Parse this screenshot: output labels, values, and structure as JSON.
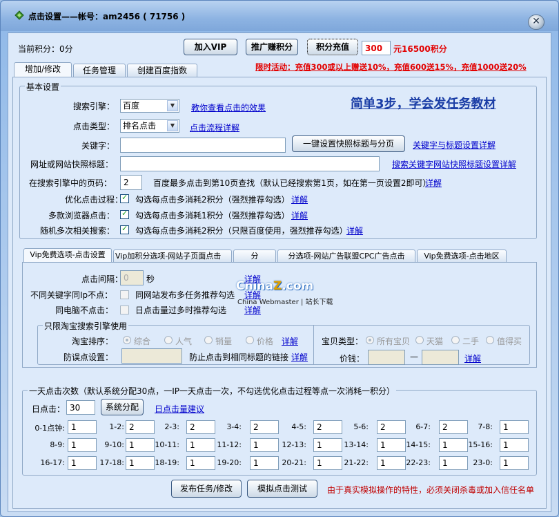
{
  "window": {
    "title": "点击设置——帐号：am2456 ( 71756 )",
    "close": "✕"
  },
  "top": {
    "points_label": "当前积分：0分",
    "vip_button": "加入VIP",
    "promo_button": "推广赚积分",
    "recharge_button": "积分充值",
    "recharge_amount": "300",
    "recharge_result": "元16500积分",
    "promo_notice": "限时活动：充值300或以上赠送10%，充值600送15%，充值1000送20%"
  },
  "tabs": [
    "增加/修改",
    "任务管理",
    "创建百度指数"
  ],
  "basic": {
    "legend": "基本设置",
    "engine_label": "搜索引擎：",
    "engine_value": "百度",
    "engine_link": "教你查看点击的效果",
    "slogan": "简单3步，学会发任务教材",
    "click_type_label": "点击类型：",
    "click_type_value": "排名点击",
    "click_type_link": "点击流程详解",
    "keyword_label": "关键字：",
    "keyword_value": "",
    "snapshot_button": "一键设置快照标题与分页",
    "snapshot_link": "关键字与标题设置详解",
    "url_label": "网址或网站快照标题：",
    "url_value": "",
    "url_link": "搜索关键字网站快照标题设置详解",
    "page_label": "在搜索引擎中的页码：",
    "page_value": "2",
    "page_hint": "百度最多点击到第10页查找（默认已经搜索第1页，如在第一页设置2即可）",
    "page_link": "详解",
    "opt1_label": "优化点击过程：",
    "opt1_text": "勾选每点击多消耗2积分（强烈推荐勾选）",
    "opt2_label": "多款浏览器点击：",
    "opt2_text": "勾选每点击多消耗1积分（强烈推荐勾选）",
    "opt3_label": "随机多次相关搜索：",
    "opt3_text": "勾选每点击多消耗2积分（只限百度使用，强烈推荐勾选）",
    "detail": "详解"
  },
  "subtabs": [
    "Vip免费选项-点击设置",
    "Vip加积分选项-网站子页面点击",
    "分",
    "分选项-网站广告联盟CPC广告点击",
    "Vip免费选项-点击地区"
  ],
  "watermark": {
    "logo": "China",
    "logo_z": "Z",
    "logo_end": ".com",
    "sub": "China Webmaster | 站长下载"
  },
  "vip": {
    "interval_label": "点击间隔：",
    "interval_value": "0",
    "interval_unit": "秒",
    "ip_label": "不同关键字同Ip不点：",
    "ip_text": "同网站发布多任务推荐勾选",
    "pc_label": "同电脑不点击：",
    "pc_text": "日点击量过多时推荐勾选",
    "detail": "详解",
    "taobao_legend": "只限淘宝搜索引擎使用",
    "sort_label": "淘宝排序：",
    "sort_options": [
      "综合",
      "人气",
      "销量",
      "价格"
    ],
    "antifake_label": "防误点设置：",
    "antifake_hint": "防止点击到相同标题的链接",
    "type_label": "宝贝类型：",
    "type_options": [
      "所有宝贝",
      "天猫",
      "二手",
      "值得买"
    ],
    "price_label": "价钱：",
    "price_sep": "—"
  },
  "daily": {
    "legend": "一天点击次数（默认系统分配30点，一IP一天点击一次，不勾选优化点击过程等点一次消耗一积分）",
    "day_label": "日点击：",
    "day_value": "30",
    "assign_button": "系统分配",
    "suggest_link": "日点击量建议",
    "slots": [
      {
        "label": "0-1点钟:",
        "value": "1"
      },
      {
        "label": "1-2:",
        "value": "2"
      },
      {
        "label": "2-3:",
        "value": "2"
      },
      {
        "label": "3-4:",
        "value": "2"
      },
      {
        "label": "4-5:",
        "value": "2"
      },
      {
        "label": "5-6:",
        "value": "2"
      },
      {
        "label": "6-7:",
        "value": "2"
      },
      {
        "label": "7-8:",
        "value": "1"
      },
      {
        "label": "8-9:",
        "value": "1"
      },
      {
        "label": "9-10:",
        "value": "1"
      },
      {
        "label": "10-11:",
        "value": "1"
      },
      {
        "label": "11-12:",
        "value": "1"
      },
      {
        "label": "12-13:",
        "value": "1"
      },
      {
        "label": "13-14:",
        "value": "1"
      },
      {
        "label": "14-15:",
        "value": "1"
      },
      {
        "label": "15-16:",
        "value": "1"
      },
      {
        "label": "16-17:",
        "value": "1"
      },
      {
        "label": "17-18:",
        "value": "1"
      },
      {
        "label": "18-19:",
        "value": "1"
      },
      {
        "label": "19-20:",
        "value": "1"
      },
      {
        "label": "20-21:",
        "value": "1"
      },
      {
        "label": "21-22:",
        "value": "1"
      },
      {
        "label": "22-23:",
        "value": "1"
      },
      {
        "label": "23-0:",
        "value": "1"
      }
    ]
  },
  "footer": {
    "publish_button": "发布任务/修改",
    "simulate_button": "模拟点击测试",
    "note": "由于真实模拟操作的特性，必须关闭杀毒或加入信任名单"
  }
}
